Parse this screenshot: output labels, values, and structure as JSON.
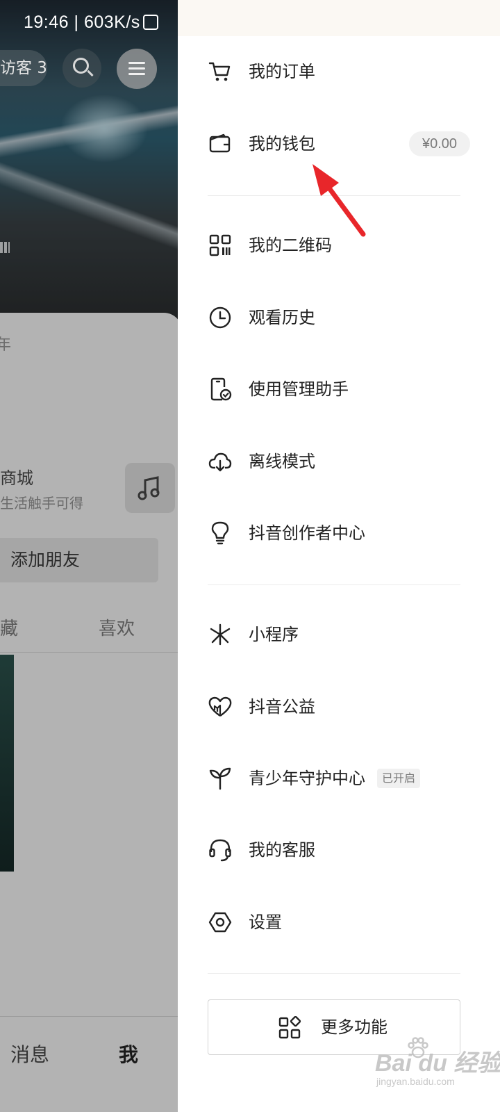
{
  "status_bar": {
    "time_speed": "19:46 | 603K/s"
  },
  "profile": {
    "visitor_label": "访客 3",
    "card_text": "年",
    "mall_title": "商城",
    "mall_subtitle": "生活触手可得",
    "add_friend_label": "添加朋友",
    "tabs": [
      "藏",
      "喜欢"
    ],
    "bottom_nav": {
      "message": "消息",
      "me": "我"
    }
  },
  "drawer": {
    "items": [
      {
        "label": "我的订单",
        "icon": "cart-icon"
      },
      {
        "label": "我的钱包",
        "icon": "wallet-icon",
        "badge": "¥0.00"
      },
      {
        "label": "我的二维码",
        "icon": "qr-code-icon"
      },
      {
        "label": "观看历史",
        "icon": "clock-icon"
      },
      {
        "label": "使用管理助手",
        "icon": "phone-check-icon"
      },
      {
        "label": "离线模式",
        "icon": "cloud-download-icon"
      },
      {
        "label": "抖音创作者中心",
        "icon": "lightbulb-icon"
      },
      {
        "label": "小程序",
        "icon": "mini-program-icon"
      },
      {
        "label": "抖音公益",
        "icon": "heart-charity-icon"
      },
      {
        "label": "青少年守护中心",
        "icon": "sprout-icon",
        "badge": "已开启"
      },
      {
        "label": "我的客服",
        "icon": "headset-icon"
      },
      {
        "label": "设置",
        "icon": "settings-icon"
      }
    ],
    "more_button_label": "更多功能"
  },
  "watermark": {
    "main": "Bai du 经验",
    "sub": "jingyan.baidu.com"
  },
  "colors": {
    "annotation_arrow": "#e8262a",
    "drawer_bg": "#ffffff",
    "overlay_dim": "#a9a9a9"
  }
}
